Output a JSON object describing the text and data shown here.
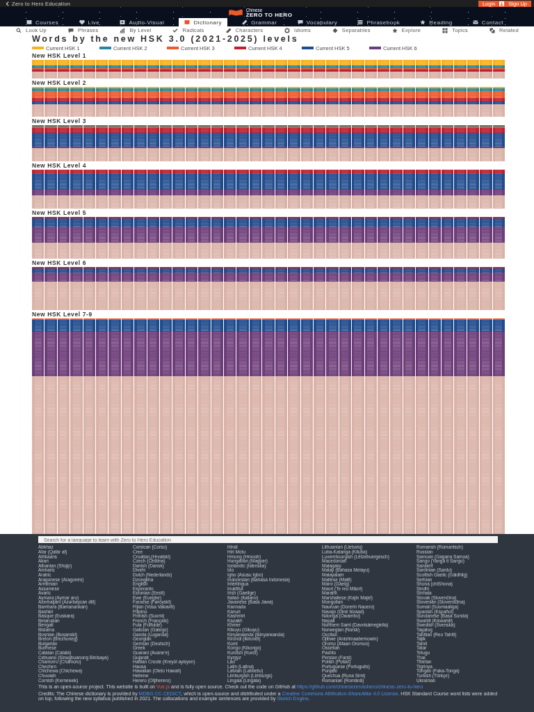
{
  "top_bar": {
    "back_link": "Zero to Hero Education",
    "account_buttons": [
      "Login",
      "Sign Up"
    ]
  },
  "logo": {
    "subtitle": "Chinese",
    "title": "ZERO TO HERO"
  },
  "nav": [
    {
      "label": "Courses",
      "selected": false
    },
    {
      "label": "Live",
      "selected": false
    },
    {
      "label": "Audio-Visual",
      "selected": false
    },
    {
      "label": "Dictionary",
      "selected": true
    },
    {
      "label": "Grammar",
      "selected": false
    },
    {
      "label": "Vocabulary",
      "selected": false
    },
    {
      "label": "Phrasebook",
      "selected": false
    },
    {
      "label": "Reading",
      "selected": false
    },
    {
      "label": "Contact",
      "selected": false
    }
  ],
  "subnav": [
    "Look Up",
    "Phrases",
    "By Level",
    "Radicals",
    "Characters",
    "Idioms",
    "Separables",
    "Explore",
    "Topics",
    "Related"
  ],
  "title": "Words by the new HSK 3.0 (2021-2025) levels",
  "legend": [
    {
      "kind": "hsk1",
      "label": "Current HSK 1",
      "color": "#f7b21e"
    },
    {
      "kind": "hsk2",
      "label": "Current HSK 2",
      "color": "#24889f"
    },
    {
      "kind": "hsk3",
      "label": "Current HSK 3",
      "color": "#ef5a2a"
    },
    {
      "kind": "hsk4",
      "label": "Current HSK 4",
      "color": "#bf1f2e"
    },
    {
      "kind": "hsk5",
      "label": "Current HSK 5",
      "color": "#204b8d"
    },
    {
      "kind": "hsk6",
      "label": "Current HSK 6",
      "color": "#6d3d79"
    }
  ],
  "sections": [
    {
      "title": "New HSK Level 1",
      "tiles": [
        {
          "kind": "hsk1"
        },
        {
          "kind": "hsk1"
        },
        {
          "kind": "hsk1"
        },
        {
          "kind": "hsk1"
        },
        {
          "kind": "hsk2"
        },
        {
          "kind": "hsk2"
        },
        {
          "kind": "hsk3"
        },
        {
          "kind": "hsk4"
        },
        {
          "kind": "other"
        },
        {
          "kind": "other"
        },
        {
          "kind": "other"
        },
        {
          "kind": "other"
        },
        {
          "kind": "other"
        }
      ]
    },
    {
      "title": "New HSK Level 2",
      "tiles": [
        {
          "kind": "hsk1"
        },
        {
          "kind": "hsk2"
        },
        {
          "kind": "hsk2"
        },
        {
          "kind": "hsk3"
        },
        {
          "kind": "hsk3"
        },
        {
          "kind": "hsk3"
        },
        {
          "kind": "hsk3"
        },
        {
          "kind": "hsk3"
        },
        {
          "kind": "hsk4"
        },
        {
          "kind": "hsk4"
        },
        {
          "kind": "hsk5"
        },
        {
          "kind": "hsk5"
        },
        {
          "kind": "other"
        },
        {
          "kind": "other"
        },
        {
          "kind": "other"
        },
        {
          "kind": "other"
        },
        {
          "kind": "other"
        },
        {
          "kind": "other"
        },
        {
          "kind": "other"
        },
        {
          "kind": "other"
        },
        {
          "kind": "other"
        }
      ]
    },
    {
      "title": "New HSK Level 3",
      "tiles": [
        {
          "kind": "hsk2"
        },
        {
          "kind": "hsk3"
        },
        {
          "kind": "hsk4"
        },
        {
          "kind": "hsk4"
        },
        {
          "kind": "hsk4"
        },
        {
          "kind": "hsk5"
        },
        {
          "kind": "hsk5"
        },
        {
          "kind": "hsk5"
        },
        {
          "kind": "hsk5"
        },
        {
          "kind": "hsk5"
        },
        {
          "kind": "hsk5"
        },
        {
          "kind": "hsk5"
        },
        {
          "kind": "hsk5"
        },
        {
          "kind": "hsk5"
        },
        {
          "kind": "hsk5"
        },
        {
          "kind": "hsk6"
        },
        {
          "kind": "other"
        },
        {
          "kind": "other"
        },
        {
          "kind": "other"
        },
        {
          "kind": "other"
        },
        {
          "kind": "other"
        },
        {
          "kind": "other"
        },
        {
          "kind": "other"
        },
        {
          "kind": "other"
        },
        {
          "kind": "other"
        }
      ]
    },
    {
      "title": "New HSK Level 4",
      "tiles": [
        {
          "kind": "hsk4"
        },
        {
          "kind": "hsk4"
        },
        {
          "kind": "hsk4"
        },
        {
          "kind": "hsk5"
        },
        {
          "kind": "hsk5"
        },
        {
          "kind": "hsk5"
        },
        {
          "kind": "hsk5"
        },
        {
          "kind": "hsk5"
        },
        {
          "kind": "hsk5"
        },
        {
          "kind": "hsk5"
        },
        {
          "kind": "hsk5"
        },
        {
          "kind": "hsk5"
        },
        {
          "kind": "hsk5"
        },
        {
          "kind": "hsk5"
        },
        {
          "kind": "hsk6"
        },
        {
          "kind": "hsk6"
        },
        {
          "kind": "hsk6"
        },
        {
          "kind": "hsk6"
        },
        {
          "kind": "other"
        },
        {
          "kind": "other"
        },
        {
          "kind": "other"
        },
        {
          "kind": "other"
        },
        {
          "kind": "other"
        },
        {
          "kind": "other"
        },
        {
          "kind": "other"
        },
        {
          "kind": "other"
        },
        {
          "kind": "other"
        }
      ]
    },
    {
      "title": "New HSK Level 5",
      "tiles": [
        {
          "kind": "hsk4"
        },
        {
          "kind": "hsk5"
        },
        {
          "kind": "hsk5"
        },
        {
          "kind": "hsk5"
        },
        {
          "kind": "hsk5"
        },
        {
          "kind": "hsk5"
        },
        {
          "kind": "hsk5"
        },
        {
          "kind": "hsk6"
        },
        {
          "kind": "hsk6"
        },
        {
          "kind": "hsk6"
        },
        {
          "kind": "hsk6"
        },
        {
          "kind": "hsk6"
        },
        {
          "kind": "hsk6"
        },
        {
          "kind": "hsk6"
        },
        {
          "kind": "hsk6"
        },
        {
          "kind": "hsk6"
        },
        {
          "kind": "hsk6"
        },
        {
          "kind": "hsk6"
        },
        {
          "kind": "other"
        },
        {
          "kind": "other"
        },
        {
          "kind": "other"
        },
        {
          "kind": "other"
        },
        {
          "kind": "other"
        },
        {
          "kind": "other"
        },
        {
          "kind": "other"
        },
        {
          "kind": "other"
        },
        {
          "kind": "other"
        },
        {
          "kind": "other"
        },
        {
          "kind": "other"
        }
      ]
    },
    {
      "title": "New HSK Level 6",
      "tiles": [
        {
          "kind": "hsk4"
        },
        {
          "kind": "hsk5"
        },
        {
          "kind": "hsk5"
        },
        {
          "kind": "hsk5"
        },
        {
          "kind": "hsk6"
        },
        {
          "kind": "hsk6"
        },
        {
          "kind": "hsk6"
        },
        {
          "kind": "hsk6"
        },
        {
          "kind": "hsk6"
        },
        {
          "kind": "hsk6"
        },
        {
          "kind": "other"
        },
        {
          "kind": "other"
        },
        {
          "kind": "other"
        },
        {
          "kind": "other"
        },
        {
          "kind": "other"
        },
        {
          "kind": "other"
        },
        {
          "kind": "other"
        },
        {
          "kind": "other"
        },
        {
          "kind": "other"
        },
        {
          "kind": "other"
        },
        {
          "kind": "other"
        },
        {
          "kind": "other"
        },
        {
          "kind": "other"
        },
        {
          "kind": "other"
        },
        {
          "kind": "other"
        },
        {
          "kind": "other"
        },
        {
          "kind": "other"
        },
        {
          "kind": "other"
        },
        {
          "kind": "other"
        },
        {
          "kind": "other"
        }
      ]
    },
    {
      "title": "New HSK Level 7-9",
      "tiles": [
        {
          "kind": "hsk3"
        },
        {
          "kind": "hsk5"
        },
        {
          "kind": "hsk5"
        },
        {
          "kind": "hsk5"
        },
        {
          "kind": "hsk5"
        },
        {
          "kind": "hsk5"
        },
        {
          "kind": "hsk5"
        },
        {
          "kind": "hsk5"
        },
        {
          "kind": "hsk5"
        },
        {
          "kind": "hsk6"
        },
        {
          "kind": "hsk6"
        },
        {
          "kind": "hsk6"
        },
        {
          "kind": "hsk6"
        },
        {
          "kind": "hsk6"
        },
        {
          "kind": "hsk6"
        },
        {
          "kind": "hsk6"
        },
        {
          "kind": "hsk6"
        },
        {
          "kind": "hsk6"
        },
        {
          "kind": "hsk6"
        },
        {
          "kind": "hsk6"
        },
        {
          "kind": "hsk6"
        },
        {
          "kind": "hsk6"
        },
        {
          "kind": "hsk6"
        },
        {
          "kind": "hsk6"
        },
        {
          "kind": "hsk6"
        },
        {
          "kind": "hsk6"
        },
        {
          "kind": "hsk6"
        },
        {
          "kind": "hsk6"
        },
        {
          "kind": "hsk6"
        },
        {
          "kind": "hsk6"
        },
        {
          "kind": "hsk6"
        },
        {
          "kind": "hsk6"
        },
        {
          "kind": "hsk6"
        },
        {
          "kind": "hsk6"
        },
        {
          "kind": "hsk6"
        },
        {
          "kind": "hsk6"
        },
        {
          "kind": "hsk6"
        },
        {
          "kind": "hsk6"
        },
        {
          "kind": "hsk6"
        },
        {
          "kind": "hsk6"
        },
        {
          "kind": "other"
        },
        {
          "kind": "other"
        },
        {
          "kind": "other"
        },
        {
          "kind": "other"
        },
        {
          "kind": "other"
        },
        {
          "kind": "other"
        },
        {
          "kind": "other"
        },
        {
          "kind": "other"
        },
        {
          "kind": "other"
        },
        {
          "kind": "other"
        },
        {
          "kind": "other"
        },
        {
          "kind": "other"
        },
        {
          "kind": "other"
        },
        {
          "kind": "other"
        },
        {
          "kind": "other"
        },
        {
          "kind": "other"
        },
        {
          "kind": "other"
        },
        {
          "kind": "other"
        },
        {
          "kind": "other"
        },
        {
          "kind": "other"
        },
        {
          "kind": "other"
        },
        {
          "kind": "other"
        },
        {
          "kind": "other"
        },
        {
          "kind": "other"
        },
        {
          "kind": "other"
        },
        {
          "kind": "other"
        },
        {
          "kind": "other"
        },
        {
          "kind": "other"
        },
        {
          "kind": "other"
        },
        {
          "kind": "other"
        },
        {
          "kind": "other"
        },
        {
          "kind": "other"
        },
        {
          "kind": "other"
        },
        {
          "kind": "other"
        },
        {
          "kind": "other"
        },
        {
          "kind": "other"
        },
        {
          "kind": "other"
        },
        {
          "kind": "other"
        },
        {
          "kind": "other"
        },
        {
          "kind": "other"
        },
        {
          "kind": "other"
        },
        {
          "kind": "other"
        },
        {
          "kind": "other"
        },
        {
          "kind": "other"
        },
        {
          "kind": "other"
        },
        {
          "kind": "other"
        },
        {
          "kind": "other"
        },
        {
          "kind": "other"
        },
        {
          "kind": "other"
        },
        {
          "kind": "other"
        },
        {
          "kind": "other"
        },
        {
          "kind": "other"
        },
        {
          "kind": "other"
        },
        {
          "kind": "other"
        },
        {
          "kind": "other"
        },
        {
          "kind": "other"
        },
        {
          "kind": "other"
        },
        {
          "kind": "other"
        },
        {
          "kind": "other"
        },
        {
          "kind": "other"
        },
        {
          "kind": "other"
        },
        {
          "kind": "other"
        },
        {
          "kind": "other"
        },
        {
          "kind": "other"
        },
        {
          "kind": "other"
        },
        {
          "kind": "other"
        },
        {
          "kind": "other"
        },
        {
          "kind": "other"
        },
        {
          "kind": "other"
        },
        {
          "kind": "other"
        },
        {
          "kind": "other"
        },
        {
          "kind": "other"
        },
        {
          "kind": "other"
        },
        {
          "kind": "other"
        },
        {
          "kind": "other"
        },
        {
          "kind": "other"
        },
        {
          "kind": "other"
        },
        {
          "kind": "other"
        },
        {
          "kind": "other"
        },
        {
          "kind": "other"
        },
        {
          "kind": "other"
        },
        {
          "kind": "other"
        },
        {
          "kind": "other"
        },
        {
          "kind": "other"
        },
        {
          "kind": "other"
        },
        {
          "kind": "other"
        },
        {
          "kind": "other"
        },
        {
          "kind": "other"
        },
        {
          "kind": "other"
        },
        {
          "kind": "other"
        },
        {
          "kind": "other"
        },
        {
          "kind": "other"
        },
        {
          "kind": "other"
        },
        {
          "kind": "other"
        },
        {
          "kind": "other"
        },
        {
          "kind": "other"
        },
        {
          "kind": "other"
        },
        {
          "kind": "other"
        },
        {
          "kind": "other"
        },
        {
          "kind": "other"
        },
        {
          "kind": "other"
        },
        {
          "kind": "other"
        },
        {
          "kind": "other"
        },
        {
          "kind": "other"
        },
        {
          "kind": "other"
        },
        {
          "kind": "other"
        },
        {
          "kind": "other"
        },
        {
          "kind": "other"
        },
        {
          "kind": "other"
        },
        {
          "kind": "other"
        }
      ]
    }
  ],
  "footer": {
    "search": {
      "placeholder": "Search for a language to learn with Zero to Hero Education"
    },
    "language_columns": [
      [
        "Abkhaz",
        "Afar (Qafár af)",
        "Afrikaans",
        "Akan",
        "Albanian (Shqip)",
        "Amharic",
        "Arabic",
        "Aragonese (Aragonés)",
        "Armenian",
        "Assamese",
        "Avaric",
        "Aymara (Aymar aru)",
        "Azerbaijani (Azərbaycan dili)",
        "Bambara (Bamanankan)",
        "Bashkir",
        "Basque (Euskara)",
        "Belarusian",
        "Bengali",
        "Bislama",
        "Bosnian (Bosanski)",
        "Breton (Brezhoneg)",
        "Bulgarian",
        "Burmese",
        "Catalan (Català)",
        "Cebuano (Sinugbuanong Binisaya)",
        "Chamorro (Chamoru)",
        "Chechen",
        "Chichewa (Chichewa)",
        "Chuvash",
        "Cornish (Kernewek)"
      ],
      [
        "Corsican (Corsu)",
        "Cree",
        "Croatian (Hrvatski)",
        "Czech (Čeština)",
        "Danish (Dansk)",
        "Divehi",
        "Dutch (Nederlands)",
        "Dzongkha",
        "English",
        "Esperanto",
        "Estonian (Eesti)",
        "Ewe (Eʋegbe)",
        "Faroese (Føroyskt)",
        "Fijian (Vosa Vakaviti)",
        "Filipino",
        "Finnish (Suomi)",
        "French (Français)",
        "Fula (Fulfulde)",
        "Galician (Galego)",
        "Ganda (Luganda)",
        "Georgian",
        "German (Deutsch)",
        "Greek",
        "Guarani (Avane'e)",
        "Gujarati",
        "Haitian Creole (Kreyòl ayisyen)",
        "Hausa",
        "Hawaiian (Olelo Hawaii)",
        "Hebrew",
        "Herero (Otjiherero)"
      ],
      [
        "Hindi",
        "Hiri Motu",
        "Hmong (Hmoob)",
        "Hungarian (Magyar)",
        "Icelandic (Íslenska)",
        "Ido",
        "Igbo (Asusu Igbo)",
        "Indonesian (Bahasa Indonesia)",
        "Interlingua",
        "Inuktitut",
        "Irish (Gaeilge)",
        "Italian (Italiano)",
        "Javanese (Basa Jawa)",
        "Kannada",
        "Kanuri",
        "Kashmiri",
        "Kazakh",
        "Khmer",
        "Kikuyu (Gikuyu)",
        "Kinyarwanda (Ikinyarwanda)",
        "Kirundi (Ikirundi)",
        "Komi",
        "Kongo (Kikongo)",
        "Kurdish (Kurdî)",
        "Kyrgyz",
        "Lao",
        "Latin (Latina)",
        "Latvian (Latviešu)",
        "Limburgish (Limburgs)",
        "Lingala (Lingála)"
      ],
      [
        "Lithuanian (Lietuvių)",
        "Luba-Katanga (Kiluba)",
        "Luxembourgish (Lëtzebuergesch)",
        "Macedonian",
        "Malagasy",
        "Malay (Bahasa Melayu)",
        "Malayalam",
        "Maltese (Malti)",
        "Manx (Gaelg)",
        "Maori (Te reo Māori)",
        "Marathi",
        "Marshallese (Kajin Majel)",
        "Mongolian",
        "Nauruan (Dorerin Naoero)",
        "Navajo (Diné bizaad)",
        "Ndonga (Owambo)",
        "Nepali",
        "Northern Sami (Davvisámegiella)",
        "Norwegian (Norsk)",
        "Occitan",
        "Ojibwe (Anishinaabemowin)",
        "Oromo (Afaan Oromoo)",
        "Ossetian",
        "Pashto",
        "Persian (Farsi)",
        "Polish (Polski)",
        "Portuguese (Português)",
        "Punjabi",
        "Quechua (Runa Simi)",
        "Romanian (Română)"
      ],
      [
        "Romansh (Rumantsch)",
        "Russian",
        "Samoan (Gagana Samoa)",
        "Sango (Yanga ti Sango)",
        "Sanskrit",
        "Sardinian (Sardu)",
        "Scottish Gaelic (Gàidhlig)",
        "Serbian",
        "Shona (chiShona)",
        "Sindhi",
        "Sinhala",
        "Slovak (Slovenčina)",
        "Slovenian (Slovenščina)",
        "Somali (Soomaaliga)",
        "Spanish (Español)",
        "Sundanese (Basa Sunda)",
        "Swahili (Kiswahili)",
        "Swedish (Svenska)",
        "Tagalog",
        "Tahitian (Reo Tahiti)",
        "Tajik",
        "Tamil",
        "Tatar",
        "Telugu",
        "Thai",
        "Tibetan",
        "Tigrinya",
        "Tongan (Faka-Tonga)",
        "Turkish (Türkçe)",
        "Ukrainian"
      ]
    ],
    "project_note": [
      {
        "kind": "text",
        "text": "This is an open-source project. This website is built on "
      },
      {
        "kind": "accent_link",
        "text": "Vue.js"
      },
      {
        "kind": "text",
        "text": " and is fully open source. Check out the code on GitHub at "
      },
      {
        "kind": "link",
        "text": "https://github.com/chinesezerotohero/chinese-zero-to-hero"
      }
    ],
    "credits": [
      {
        "kind": "text",
        "text": "Credits: The Chinese dictionary is provided by "
      },
      {
        "kind": "link",
        "text": "MDBG CC-CEDICT"
      },
      {
        "kind": "text",
        "text": ", which is open-source and distributed under a "
      },
      {
        "kind": "link",
        "text": "Creative Commons Attribution-ShareAlike 4.0 License"
      },
      {
        "kind": "text",
        "text": ". HSK Standard Course word lists were added on top, following the new syllabus published in 2021. The collocations and example sentences are provided by "
      },
      {
        "kind": "link",
        "text": "Sketch Engine"
      },
      {
        "kind": "text",
        "text": "."
      }
    ]
  }
}
